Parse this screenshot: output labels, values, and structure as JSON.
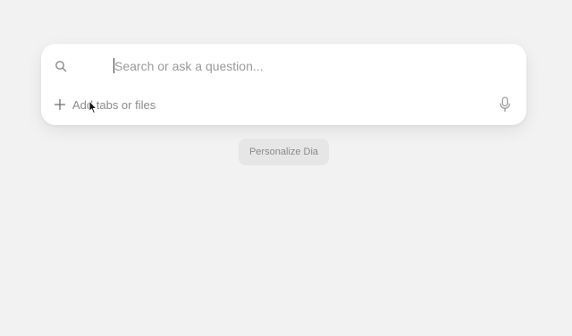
{
  "search": {
    "placeholder": "Search or ask a question..."
  },
  "attach": {
    "label": "Add tabs or files"
  },
  "personalize": {
    "label": "Personalize Dia"
  },
  "icons": {
    "search": "search-icon",
    "plus": "plus-icon",
    "microphone": "microphone-icon",
    "cursor": "mouse-pointer-icon"
  },
  "colors": {
    "background": "#f2f2f2",
    "card": "#ffffff",
    "button": "#e6e6e6",
    "placeholder": "#9a9a9a"
  }
}
